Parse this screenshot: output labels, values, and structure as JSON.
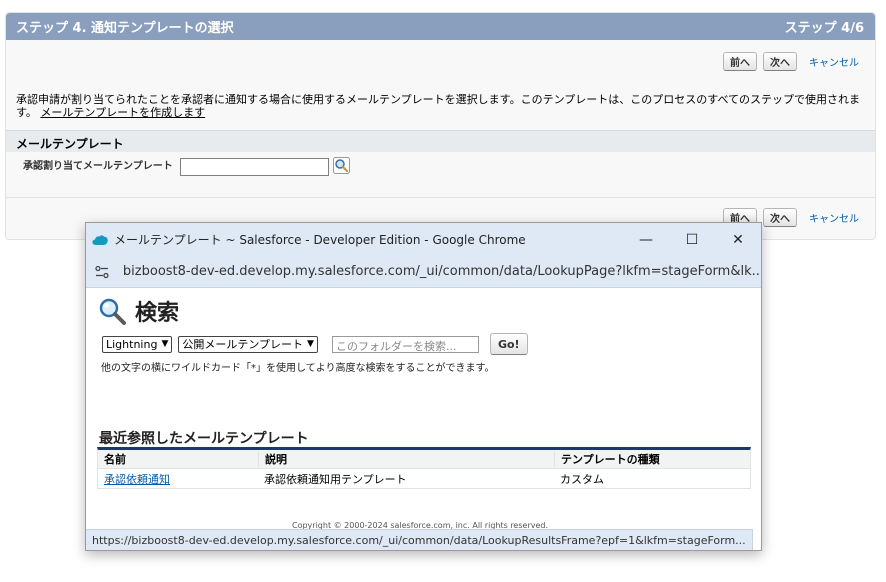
{
  "wizard": {
    "header_title": "ステップ 4. 通知テンプレートの選択",
    "header_step": "ステップ 4/6",
    "prev_label": "前へ",
    "next_label": "次へ",
    "cancel_label": "キャンセル",
    "description_text": "承認申請が割り当てられたことを承認者に通知する場合に使用するメールテンプレートを選択します。このテンプレートは、このプロセスのすべてのステップで使用されます。",
    "description_link": "メールテンプレートを作成します",
    "section_title": "メールテンプレート",
    "field_label": "承認割り当てメールテンプレート",
    "field_value": ""
  },
  "popup": {
    "window_title": "メールテンプレート ~ Salesforce - Developer Edition - Google Chrome",
    "url": "bizboost8-dev-ed.develop.my.salesforce.com/_ui/common/data/LookupPage?lkfm=stageForm&lk...",
    "search_title": "検索",
    "select_type": "Lightning",
    "select_folder": "公開メールテンプレート",
    "search_placeholder": "このフォルダーを検索...",
    "go_label": "Go!",
    "hint": "他の文字の横にワイルドカード「*」を使用してより高度な検索をすることができます。",
    "recent_title": "最近参照したメールテンプレート",
    "columns": [
      "名前",
      "説明",
      "テンプレートの種類"
    ],
    "rows": [
      {
        "name": "承認依頼通知",
        "description": "承認依頼通知用テンプレート",
        "type": "カスタム"
      }
    ],
    "copyright": "Copyright © 2000-2024 salesforce.com, inc. All rights reserved.",
    "status_url": "https://bizboost8-dev-ed.develop.my.salesforce.com/_ui/common/data/LookupResultsFrame?epf=1&lkfm=stageForm..."
  },
  "colors": {
    "header_bg": "#8a9ebe",
    "link": "#015ba7",
    "chrome_frame": "#dfe8f5",
    "table_accent": "#1b3a66"
  }
}
